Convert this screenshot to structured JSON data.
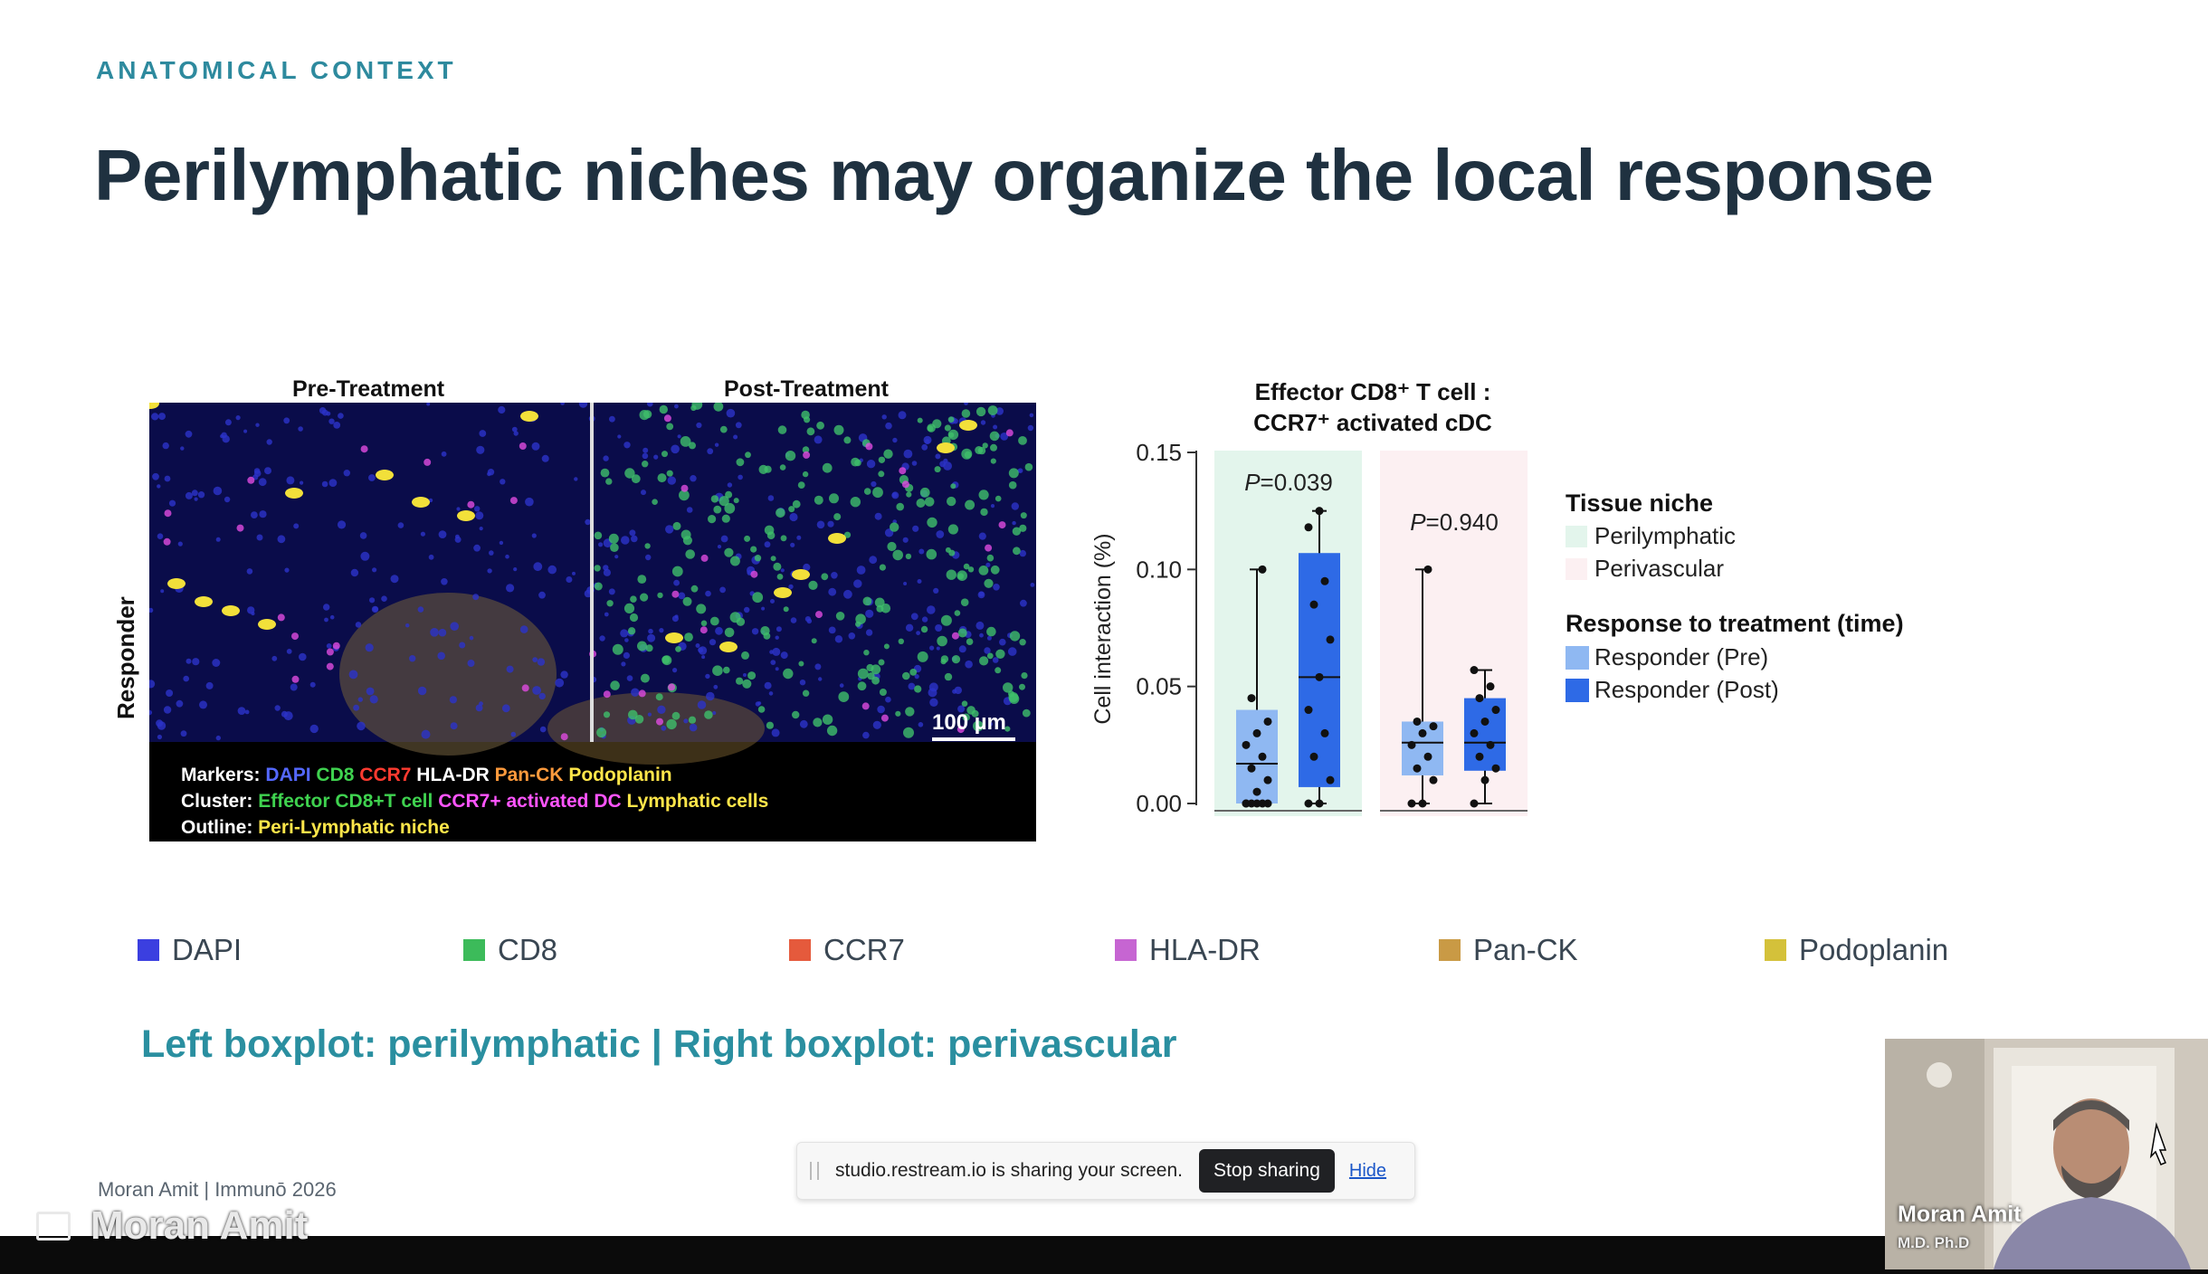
{
  "slide": {
    "kicker": "ANATOMICAL CONTEXT",
    "title": "Perilymphatic niches may organize the local response",
    "caption": "Left boxplot: perilymphatic | Right boxplot: perivascular",
    "footer": "Moran Amit | Immunō 2026"
  },
  "microscopy": {
    "pre_label": "Pre-Treatment",
    "post_label": "Post-Treatment",
    "row_label": "Responder",
    "scale_bar": "100 µm",
    "markers_label": "Markers:",
    "markers": [
      {
        "text": "DAPI",
        "color": "#5468ff"
      },
      {
        "text": "CD8",
        "color": "#3fd24f"
      },
      {
        "text": "CCR7",
        "color": "#ff3b30"
      },
      {
        "text": "HLA-DR",
        "color": "#ffffff"
      },
      {
        "text": "Pan-CK",
        "color": "#ff9a3c"
      },
      {
        "text": "Podoplanin",
        "color": "#ffe64a"
      }
    ],
    "cluster_label": "Cluster:",
    "clusters": [
      {
        "text": "Effector CD8+T cell",
        "color": "#3fd24f"
      },
      {
        "text": "CCR7+ activated DC",
        "color": "#ff55ff"
      },
      {
        "text": "Lymphatic cells",
        "color": "#ffe64a"
      }
    ],
    "outline_label": "Outline:",
    "outline": {
      "text": "Peri-Lymphatic niche",
      "color": "#ffe64a"
    }
  },
  "chart_data": {
    "type": "box",
    "title_line1": "Effector CD8⁺ T cell :",
    "title_line2": "CCR7⁺ activated cDC",
    "ylabel": "Cell interaction (%)",
    "ylim": [
      0,
      0.15
    ],
    "yticks": [
      "0.00",
      "0.05",
      "0.10",
      "0.15"
    ],
    "groups": [
      {
        "niche": "Perilymphatic",
        "p_value": "=0.039",
        "boxes": [
          {
            "series": "Responder (Pre)",
            "min": 0.0,
            "q1": 0.0,
            "median": 0.017,
            "q3": 0.04,
            "max": 0.1,
            "points": [
              0,
              0,
              0,
              0,
              0,
              0,
              0.005,
              0.01,
              0.015,
              0.02,
              0.025,
              0.03,
              0.035,
              0.045,
              0.1
            ]
          },
          {
            "series": "Responder (Post)",
            "min": 0.0,
            "q1": 0.007,
            "median": 0.054,
            "q3": 0.107,
            "max": 0.125,
            "points": [
              0,
              0,
              0.01,
              0.02,
              0.03,
              0.04,
              0.054,
              0.07,
              0.085,
              0.095,
              0.118,
              0.125
            ]
          }
        ]
      },
      {
        "niche": "Perivascular",
        "p_value": "=0.940",
        "boxes": [
          {
            "series": "Responder (Pre)",
            "min": 0.0,
            "q1": 0.012,
            "median": 0.026,
            "q3": 0.035,
            "max": 0.1,
            "points": [
              0,
              0,
              0.01,
              0.015,
              0.02,
              0.025,
              0.03,
              0.033,
              0.035,
              0.1
            ]
          },
          {
            "series": "Responder (Post)",
            "min": 0.0,
            "q1": 0.014,
            "median": 0.026,
            "q3": 0.045,
            "max": 0.057,
            "points": [
              0,
              0.01,
              0.015,
              0.02,
              0.025,
              0.03,
              0.035,
              0.04,
              0.045,
              0.05,
              0.057
            ]
          }
        ]
      }
    ],
    "legend": {
      "niche_title": "Tissue niche",
      "niche_items": [
        {
          "label": "Perilymphatic",
          "color": "#e3f5ec"
        },
        {
          "label": "Perivascular",
          "color": "#fcf0f2"
        }
      ],
      "response_title": "Response to treatment (time)",
      "response_items": [
        {
          "label": "Responder (Pre)",
          "color": "#8fb8f2"
        },
        {
          "label": "Responder (Post)",
          "color": "#2e6ae6"
        }
      ]
    }
  },
  "channel_legend": [
    {
      "label": "DAPI",
      "color": "#3b3fe0"
    },
    {
      "label": "CD8",
      "color": "#3cbb5a"
    },
    {
      "label": "CCR7",
      "color": "#e55a3c"
    },
    {
      "label": "HLA-DR",
      "color": "#c665d2"
    },
    {
      "label": "Pan-CK",
      "color": "#c99a45"
    },
    {
      "label": "Podoplanin",
      "color": "#d4c13a"
    }
  ],
  "share_bar": {
    "message": "studio.restream.io is sharing your screen.",
    "stop_label": "Stop sharing",
    "hide_label": "Hide"
  },
  "presenter": {
    "overlay_name": "Moran Amit",
    "cam_name": "Moran Amit",
    "cam_title": "M.D. Ph.D"
  }
}
